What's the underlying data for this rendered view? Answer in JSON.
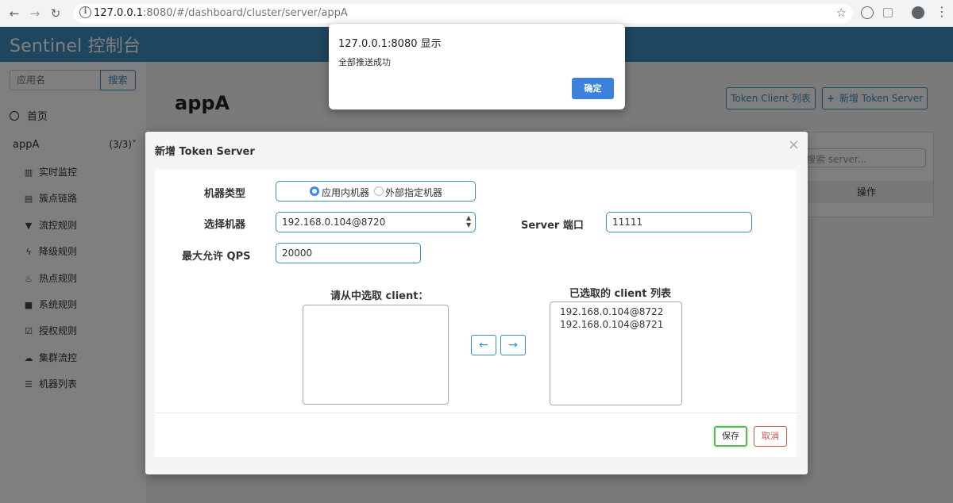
{
  "browser": {
    "url_host": "127.0.0.1",
    "url_rest": ":8080/#/dashboard/cluster/server/appA",
    "back_glyph": "←",
    "forward_glyph": "→",
    "reload_glyph": "↻",
    "info_glyph": "i",
    "star_glyph": "☆",
    "menu_glyph": "⋮"
  },
  "header": {
    "brand": "Sentinel 控制台"
  },
  "sidebar": {
    "search_placeholder": "应用名",
    "search_button": "搜索",
    "home": "首页",
    "app_name": "appA",
    "app_count": "(3/3)",
    "expand_glyph": "˅",
    "items": [
      {
        "label": "实时监控",
        "icon": "bar-chart-icon",
        "glyph": "▥"
      },
      {
        "label": "簇点链路",
        "icon": "list-icon",
        "glyph": "▤"
      },
      {
        "label": "流控规则",
        "icon": "filter-icon",
        "glyph": "▼"
      },
      {
        "label": "降级规则",
        "icon": "flash-icon",
        "glyph": "ϟ"
      },
      {
        "label": "热点规则",
        "icon": "fire-icon",
        "glyph": "♨"
      },
      {
        "label": "系统规则",
        "icon": "lock-icon",
        "glyph": "■"
      },
      {
        "label": "授权规则",
        "icon": "check-square-icon",
        "glyph": "☑"
      },
      {
        "label": "集群流控",
        "icon": "cloud-icon",
        "glyph": "☁"
      },
      {
        "label": "机器列表",
        "icon": "th-list-icon",
        "glyph": "☰"
      }
    ]
  },
  "main": {
    "title": "appA",
    "token_client_button": "Token Client 列表",
    "add_token_server_button": "新增 Token Server",
    "add_glyph": "+",
    "search_placeholder": "搜索 server...",
    "table_header_action": "操作"
  },
  "modal": {
    "title": "新增 Token Server",
    "close_glyph": "×",
    "machine_type_label": "机器类型",
    "radio_in_app": "应用内机器",
    "radio_external": "外部指定机器",
    "select_machine_label": "选择机器",
    "selected_machine": "192.168.0.104@8720",
    "select_arrow_glyph": "▲▼",
    "server_port_label": "Server 端口",
    "server_port_value": "11111",
    "max_qps_label": "最大允许 QPS",
    "max_qps_value": "20000",
    "available_clients_title": "请从中选取 client：",
    "selected_clients_title": "已选取的 client 列表",
    "selected_clients": [
      "192.168.0.104@8722",
      "192.168.0.104@8721"
    ],
    "move_left_glyph": "←",
    "move_right_glyph": "→",
    "save_button": "保存",
    "cancel_button": "取消"
  },
  "alert": {
    "title": "127.0.0.1:8080 显示",
    "message": "全部推送成功",
    "ok_button": "确定"
  },
  "colors": {
    "brand": "#3c8dbc",
    "primary": "#3c82dc",
    "success": "#5cb85c",
    "danger": "#d9534f"
  }
}
